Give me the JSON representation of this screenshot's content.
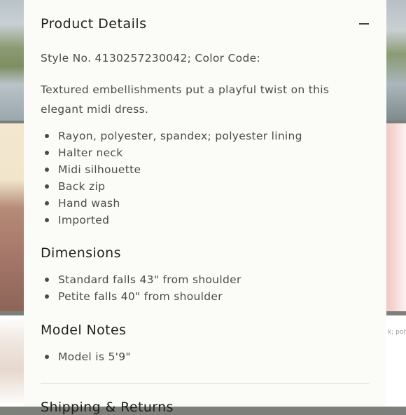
{
  "background": {
    "right_peek_text": "k; polye"
  },
  "panel": {
    "title": "Product Details",
    "collapse_icon": "minus-icon",
    "style_line": "Style No. 4130257230042; Color Code:",
    "description": "Textured embellishments put a playful twist on this elegant midi dress.",
    "features": [
      "Rayon, polyester, spandex; polyester lining",
      "Halter neck",
      "Midi silhouette",
      "Back zip",
      "Hand wash",
      "Imported"
    ],
    "dimensions": {
      "heading": "Dimensions",
      "items": [
        "Standard falls 43\" from shoulder",
        "Petite falls 40\" from shoulder"
      ]
    },
    "model_notes": {
      "heading": "Model Notes",
      "items": [
        "Model is 5'9\""
      ]
    },
    "next_section_label": "Shipping & Returns"
  }
}
